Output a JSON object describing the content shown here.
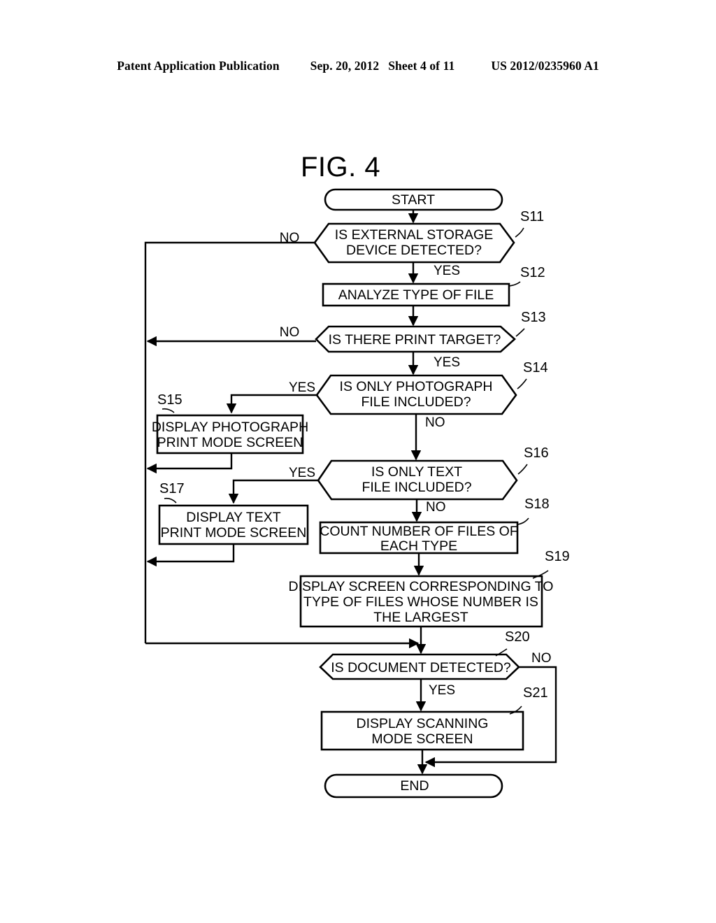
{
  "header": {
    "publication": "Patent Application Publication",
    "date": "Sep. 20, 2012",
    "sheet": "Sheet 4 of 11",
    "number": "US 2012/0235960 A1"
  },
  "figure": {
    "title": "FIG. 4"
  },
  "chart_data": {
    "type": "diagram",
    "title": "FIG. 4",
    "nodes": [
      {
        "id": "start",
        "shape": "terminator",
        "label": "START"
      },
      {
        "id": "S11",
        "shape": "decision",
        "step": "S11",
        "label": "IS EXTERNAL STORAGE DEVICE DETECTED?"
      },
      {
        "id": "S12",
        "shape": "process",
        "step": "S12",
        "label": "ANALYZE TYPE OF FILE"
      },
      {
        "id": "S13",
        "shape": "decision",
        "step": "S13",
        "label": "IS THERE PRINT TARGET?"
      },
      {
        "id": "S14",
        "shape": "decision",
        "step": "S14",
        "label": "IS ONLY PHOTOGRAPH FILE INCLUDED?"
      },
      {
        "id": "S15",
        "shape": "process",
        "step": "S15",
        "label": "DISPLAY PHOTOGRAPH PRINT MODE SCREEN"
      },
      {
        "id": "S16",
        "shape": "decision",
        "step": "S16",
        "label": "IS ONLY TEXT FILE INCLUDED?"
      },
      {
        "id": "S17",
        "shape": "process",
        "step": "S17",
        "label": "DISPLAY TEXT PRINT MODE SCREEN"
      },
      {
        "id": "S18",
        "shape": "process",
        "step": "S18",
        "label": "COUNT NUMBER OF FILES OF EACH TYPE"
      },
      {
        "id": "S19",
        "shape": "process",
        "step": "S19",
        "label": "DISPLAY SCREEN CORRESPONDING TO TYPE OF FILES WHOSE NUMBER IS THE LARGEST"
      },
      {
        "id": "S20",
        "shape": "decision",
        "step": "S20",
        "label": "IS DOCUMENT DETECTED?"
      },
      {
        "id": "S21",
        "shape": "process",
        "step": "S21",
        "label": "DISPLAY SCANNING MODE SCREEN"
      },
      {
        "id": "end",
        "shape": "terminator",
        "label": "END"
      }
    ],
    "edges": [
      {
        "from": "start",
        "to": "S11",
        "label": ""
      },
      {
        "from": "S11",
        "to": "S12",
        "label": "YES"
      },
      {
        "from": "S11",
        "to": "S20",
        "label": "NO"
      },
      {
        "from": "S12",
        "to": "S13",
        "label": ""
      },
      {
        "from": "S13",
        "to": "S14",
        "label": "YES"
      },
      {
        "from": "S13",
        "to": "S20",
        "label": "NO"
      },
      {
        "from": "S14",
        "to": "S15",
        "label": "YES"
      },
      {
        "from": "S14",
        "to": "S16",
        "label": "NO"
      },
      {
        "from": "S15",
        "to": "S20",
        "label": ""
      },
      {
        "from": "S16",
        "to": "S17",
        "label": "YES"
      },
      {
        "from": "S16",
        "to": "S18",
        "label": "NO"
      },
      {
        "from": "S17",
        "to": "S20",
        "label": ""
      },
      {
        "from": "S18",
        "to": "S19",
        "label": ""
      },
      {
        "from": "S19",
        "to": "S20",
        "label": ""
      },
      {
        "from": "S20",
        "to": "S21",
        "label": "YES"
      },
      {
        "from": "S20",
        "to": "end",
        "label": "NO"
      },
      {
        "from": "S21",
        "to": "end",
        "label": ""
      }
    ]
  },
  "flow": {
    "start_label": "START",
    "end_label": "END",
    "s11_line1": "IS EXTERNAL STORAGE",
    "s11_line2": "DEVICE DETECTED?",
    "s11_step": "S11",
    "s11_no": "NO",
    "s11_yes": "YES",
    "s12_line1": "ANALYZE TYPE OF FILE",
    "s12_step": "S12",
    "s13_line1": "IS THERE PRINT TARGET?",
    "s13_step": "S13",
    "s13_no": "NO",
    "s13_yes": "YES",
    "s14_line1": "IS ONLY PHOTOGRAPH",
    "s14_line2": "FILE INCLUDED?",
    "s14_step": "S14",
    "s14_yes": "YES",
    "s14_no": "NO",
    "s15_line1": "DISPLAY PHOTOGRAPH",
    "s15_line2": "PRINT MODE SCREEN",
    "s15_step": "S15",
    "s16_line1": "IS ONLY TEXT",
    "s16_line2": "FILE INCLUDED?",
    "s16_step": "S16",
    "s16_yes": "YES",
    "s16_no": "NO",
    "s17_line1": "DISPLAY TEXT",
    "s17_line2": "PRINT MODE SCREEN",
    "s17_step": "S17",
    "s18_line1": "COUNT NUMBER OF FILES OF",
    "s18_line2": "EACH TYPE",
    "s18_step": "S18",
    "s19_line1": "DISPLAY SCREEN CORRESPONDING TO",
    "s19_line2": "TYPE OF FILES WHOSE NUMBER IS",
    "s19_line3": "THE LARGEST",
    "s19_step": "S19",
    "s20_line1": "IS DOCUMENT DETECTED?",
    "s20_step": "S20",
    "s20_no": "NO",
    "s20_yes": "YES",
    "s21_line1": "DISPLAY SCANNING",
    "s21_line2": "MODE SCREEN",
    "s21_step": "S21"
  }
}
